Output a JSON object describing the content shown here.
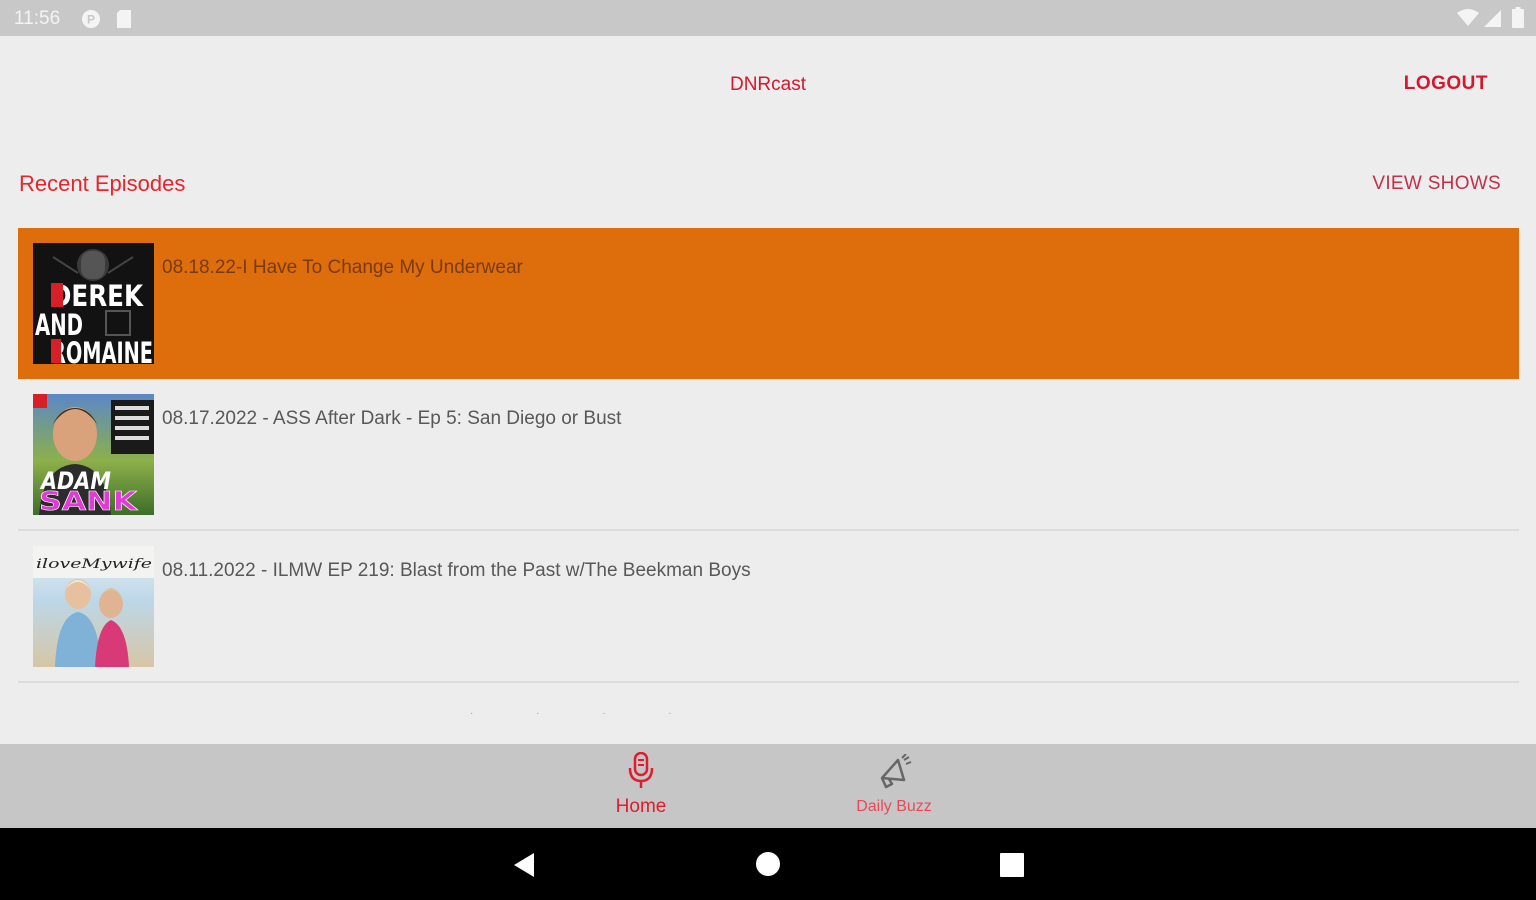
{
  "status_bar": {
    "time": "11:56",
    "icons_left": [
      "p-circle-icon",
      "sd-card-icon"
    ],
    "icons_right": [
      "wifi-icon",
      "signal-icon",
      "battery-icon"
    ]
  },
  "header": {
    "title": "DNRcast",
    "logout_label": "LOGOUT"
  },
  "section": {
    "title": "Recent Episodes",
    "view_shows_label": "VIEW SHOWS"
  },
  "episodes": [
    {
      "title": "08.18.22-I Have To Change My Underwear",
      "thumb_text": [
        "DEREK",
        "AND",
        "ROMAINE"
      ],
      "active": true
    },
    {
      "title": "08.17.2022 - ASS After Dark - Ep 5: San Diego or Bust",
      "thumb_text": [
        "ADAM",
        "SANK"
      ],
      "active": false
    },
    {
      "title": "08.11.2022 - ILMW EP 219: Blast from the Past w/The Beekman Boys",
      "thumb_text": [
        "iloveMywife"
      ],
      "active": false
    }
  ],
  "bottom_nav": {
    "home_label": "Home",
    "buzz_label": "Daily Buzz"
  },
  "colors": {
    "accent": "#d6172e",
    "active_row": "#dd6e0b",
    "background": "#ededed",
    "nav_background": "#c6c6c6"
  }
}
